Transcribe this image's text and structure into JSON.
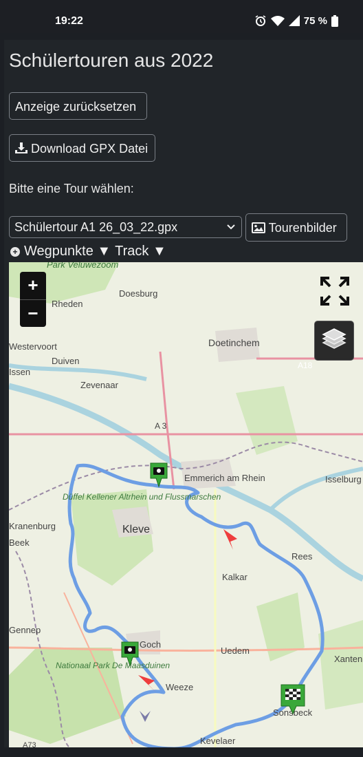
{
  "status_bar": {
    "time": "19:22",
    "battery": "75 %"
  },
  "page": {
    "title": "Schülertouren aus 2022",
    "reset_button": "Anzeige zurücksetzen",
    "download_button": "Download GPX Datei",
    "choose_label": "Bitte eine Tour wählen:",
    "selected_tour": "Schülertour A1 26_03_22.gpx",
    "pictures_button": "Tourenbilder",
    "toggles": {
      "waypoints": "Wegpunkte ▼",
      "track": "Track ▼"
    }
  },
  "map": {
    "zoom_in": "+",
    "zoom_out": "−",
    "place_labels": [
      "Park Veluwezoom",
      "Rheden",
      "Doesburg",
      "Westervoort",
      "Duiven",
      "Zevenaar",
      "Doetinchem",
      "A18",
      "A 3",
      "Emmerich am Rhein",
      "Isselburg",
      "Düffel Kellener Altrhein und Flussmarschen",
      "Kranenburg",
      "Kleve",
      "Kalkar",
      "Rees",
      "Gennep",
      "Goch",
      "Uedem",
      "Xanten",
      "Nationaal Park De Maasduinen",
      "Weeze",
      "Sonsbeck",
      "Kevelaer",
      "Issen",
      "A73",
      "Beek"
    ]
  }
}
